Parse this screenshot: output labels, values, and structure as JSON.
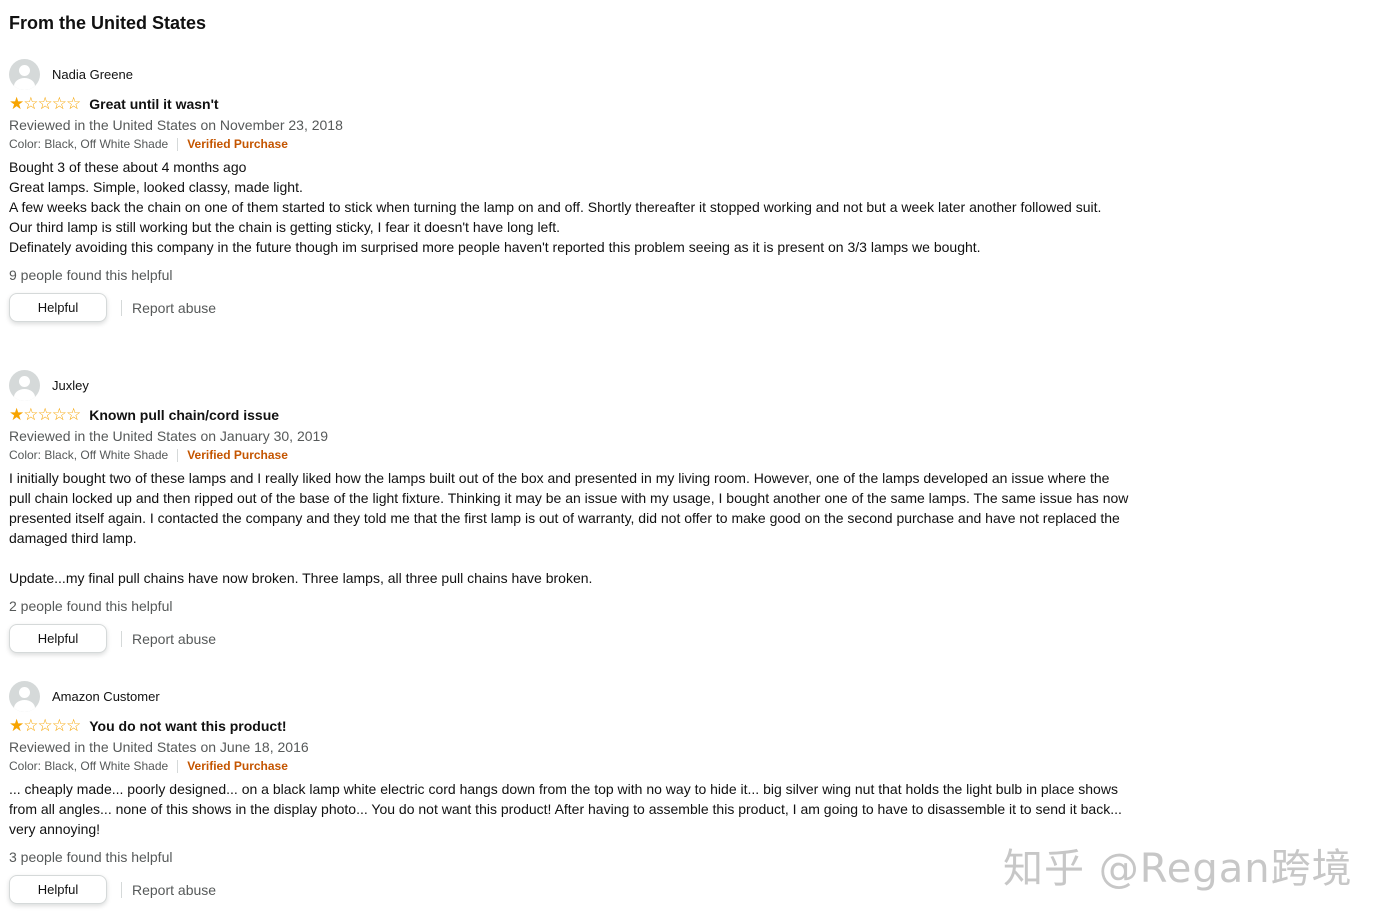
{
  "section_title": "From the United States",
  "reviews": [
    {
      "name": "Nadia Greene",
      "rating": 1,
      "rating_max": 5,
      "title": "Great until it wasn't",
      "date": "Reviewed in the United States on November 23, 2018",
      "format": "Color: Black, Off White Shade",
      "verified": "Verified Purchase",
      "body": [
        "Bought 3 of these about 4 months ago",
        "Great lamps. Simple, looked classy, made light.",
        "A few weeks back the chain on one of them started to stick when turning the lamp on and off. Shortly thereafter it stopped working and not but a week later another followed suit.",
        "Our third lamp is still working but the chain is getting sticky, I fear it doesn't have long left.",
        "Definately avoiding this company in the future though im surprised more people haven't reported this problem seeing as it is present on 3/3 lamps we bought."
      ],
      "helpful_count": "9 people found this helpful",
      "helpful_label": "Helpful",
      "report_label": "Report abuse"
    },
    {
      "name": "Juxley",
      "rating": 1,
      "rating_max": 5,
      "title": "Known pull chain/cord issue",
      "date": "Reviewed in the United States on January 30, 2019",
      "format": "Color: Black, Off White Shade",
      "verified": "Verified Purchase",
      "body": [
        "I initially bought two of these lamps and I really liked how the lamps built out of the box and presented in my living room. However, one of the lamps developed an issue where the pull chain locked up and then ripped out of the base of the light fixture. Thinking it may be an issue with my usage, I bought another one of the same lamps. The same issue has now presented itself again. I contacted the company and they told me that the first lamp is out of warranty, did not offer to make good on the second purchase and have not replaced the damaged third lamp.",
        "",
        "Update...my final pull chains have now broken. Three lamps, all three pull chains have broken."
      ],
      "helpful_count": "2 people found this helpful",
      "helpful_label": "Helpful",
      "report_label": "Report abuse"
    },
    {
      "name": "Amazon Customer",
      "rating": 1,
      "rating_max": 5,
      "title": "You do not want this product!",
      "date": "Reviewed in the United States on June 18, 2016",
      "format": "Color: Black, Off White Shade",
      "verified": "Verified Purchase",
      "body": [
        "... cheaply made... poorly designed... on a black lamp white electric cord hangs down from the top with no way to hide it... big silver wing nut that holds the light bulb in place shows from all angles... none of this shows in the display photo... You do not want this product! After having to assemble this product, I am going to have to disassemble it to send it back... very annoying!"
      ],
      "helpful_count": "3 people found this helpful",
      "helpful_label": "Helpful",
      "report_label": "Report abuse"
    }
  ],
  "watermark": "知乎 @Regan跨境",
  "colors": {
    "star": "#f7a400",
    "verified": "#c45500",
    "secondary_text": "#565959",
    "button_border": "#d5d9d9"
  },
  "icons": {
    "avatar": "default-user-avatar-icon",
    "star": "star-icon"
  }
}
